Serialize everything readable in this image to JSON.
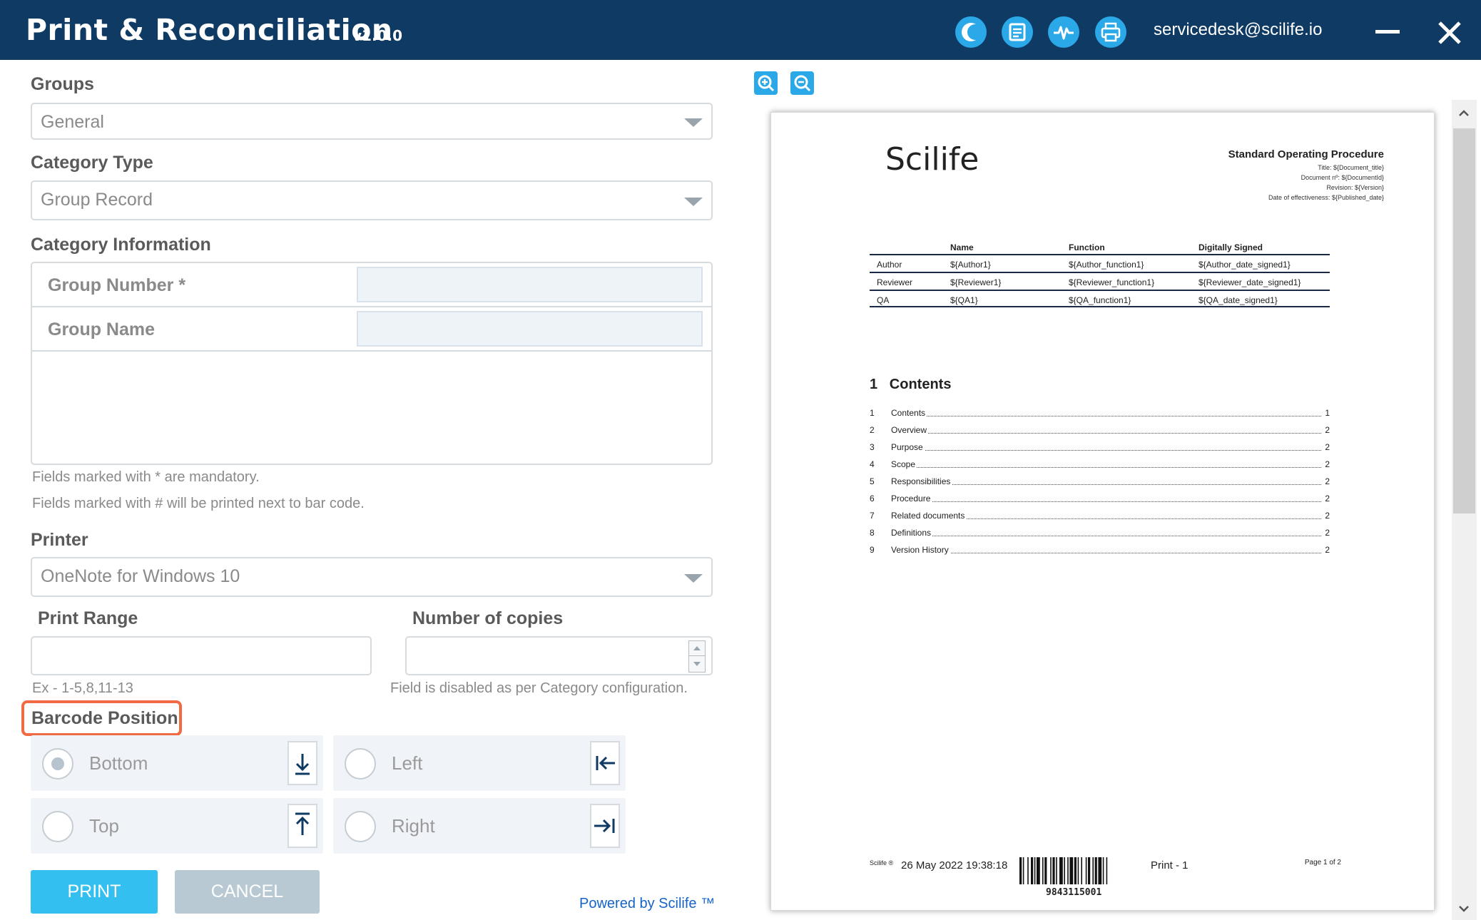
{
  "titlebar": {
    "app_title": "Print & Reconciliation",
    "version": "v1.0.0",
    "email": "servicedesk@scilife.io",
    "icons": [
      "theme-toggle-icon",
      "notes-icon",
      "activity-icon",
      "printer-icon"
    ]
  },
  "form": {
    "groups": {
      "label": "Groups",
      "value": "General"
    },
    "category_type": {
      "label": "Category Type",
      "value": "Group Record"
    },
    "category_information": {
      "label": "Category Information",
      "fields": [
        {
          "label": "Group Number *",
          "value": ""
        },
        {
          "label": "Group Name",
          "value": ""
        }
      ]
    },
    "notes": {
      "mandatory": "Fields marked with * are mandatory.",
      "barcode": "Fields marked with # will be printed next to bar code."
    },
    "printer": {
      "label": "Printer",
      "value": "OneNote for Windows 10"
    },
    "print_range": {
      "label": "Print Range",
      "value": "",
      "hint": "Ex - 1-5,8,11-13"
    },
    "copies": {
      "label": "Number of copies",
      "value": "",
      "hint": "Field is disabled as per Category configuration."
    },
    "barcode_position": {
      "label": "Barcode Position",
      "options": [
        {
          "label": "Bottom",
          "selected": true,
          "icon": "arrow-to-bottom-icon"
        },
        {
          "label": "Left",
          "selected": false,
          "icon": "arrow-to-left-icon"
        },
        {
          "label": "Top",
          "selected": false,
          "icon": "arrow-to-top-icon"
        },
        {
          "label": "Right",
          "selected": false,
          "icon": "arrow-to-right-icon"
        }
      ]
    },
    "buttons": {
      "print": "PRINT",
      "cancel": "CANCEL"
    },
    "powered_by": "Powered by Scilife ™"
  },
  "preview": {
    "logo": "Scilife",
    "doc_type": "Standard Operating Procedure",
    "meta": [
      "Title: ${Document_title}",
      "Document nº: ${DocumentId}",
      "Revision: ${Version}",
      "Date of effectiveness: ${Published_date}"
    ],
    "signature_table": {
      "headers": [
        "Name",
        "Function",
        "Digitally Signed"
      ],
      "rows": [
        [
          "Author",
          "${Author1}",
          "${Author_function1}",
          "${Author_date_signed1}"
        ],
        [
          "Reviewer",
          "${Reviewer1}",
          "${Reviewer_function1}",
          "${Reviewer_date_signed1}"
        ],
        [
          "QA",
          "${QA1}",
          "${QA_function1}",
          "${QA_date_signed1}"
        ]
      ]
    },
    "contents": {
      "number": "1",
      "title": "Contents",
      "items": [
        {
          "num": "1",
          "title": "Contents",
          "page": "1"
        },
        {
          "num": "2",
          "title": "Overview",
          "page": "2"
        },
        {
          "num": "3",
          "title": "Purpose",
          "page": "2"
        },
        {
          "num": "4",
          "title": "Scope",
          "page": "2"
        },
        {
          "num": "5",
          "title": "Responsibilities",
          "page": "2"
        },
        {
          "num": "6",
          "title": "Procedure",
          "page": "2"
        },
        {
          "num": "7",
          "title": "Related documents",
          "page": "2"
        },
        {
          "num": "8",
          "title": "Definitions",
          "page": "2"
        },
        {
          "num": "9",
          "title": "Version History",
          "page": "2"
        }
      ]
    },
    "footer": {
      "brand": "Scilife ®",
      "datetime": "26 May 2022 19:38:18",
      "barcode_number": "9843115001",
      "print_label": "Print - 1",
      "page_label": "Page 1 of 2"
    }
  },
  "colors": {
    "titlebar": "#0e3a63",
    "accent": "#2aa8e8",
    "print_button": "#33bff0",
    "cancel_button": "#b9c9d3",
    "highlight": "#f26a43"
  }
}
